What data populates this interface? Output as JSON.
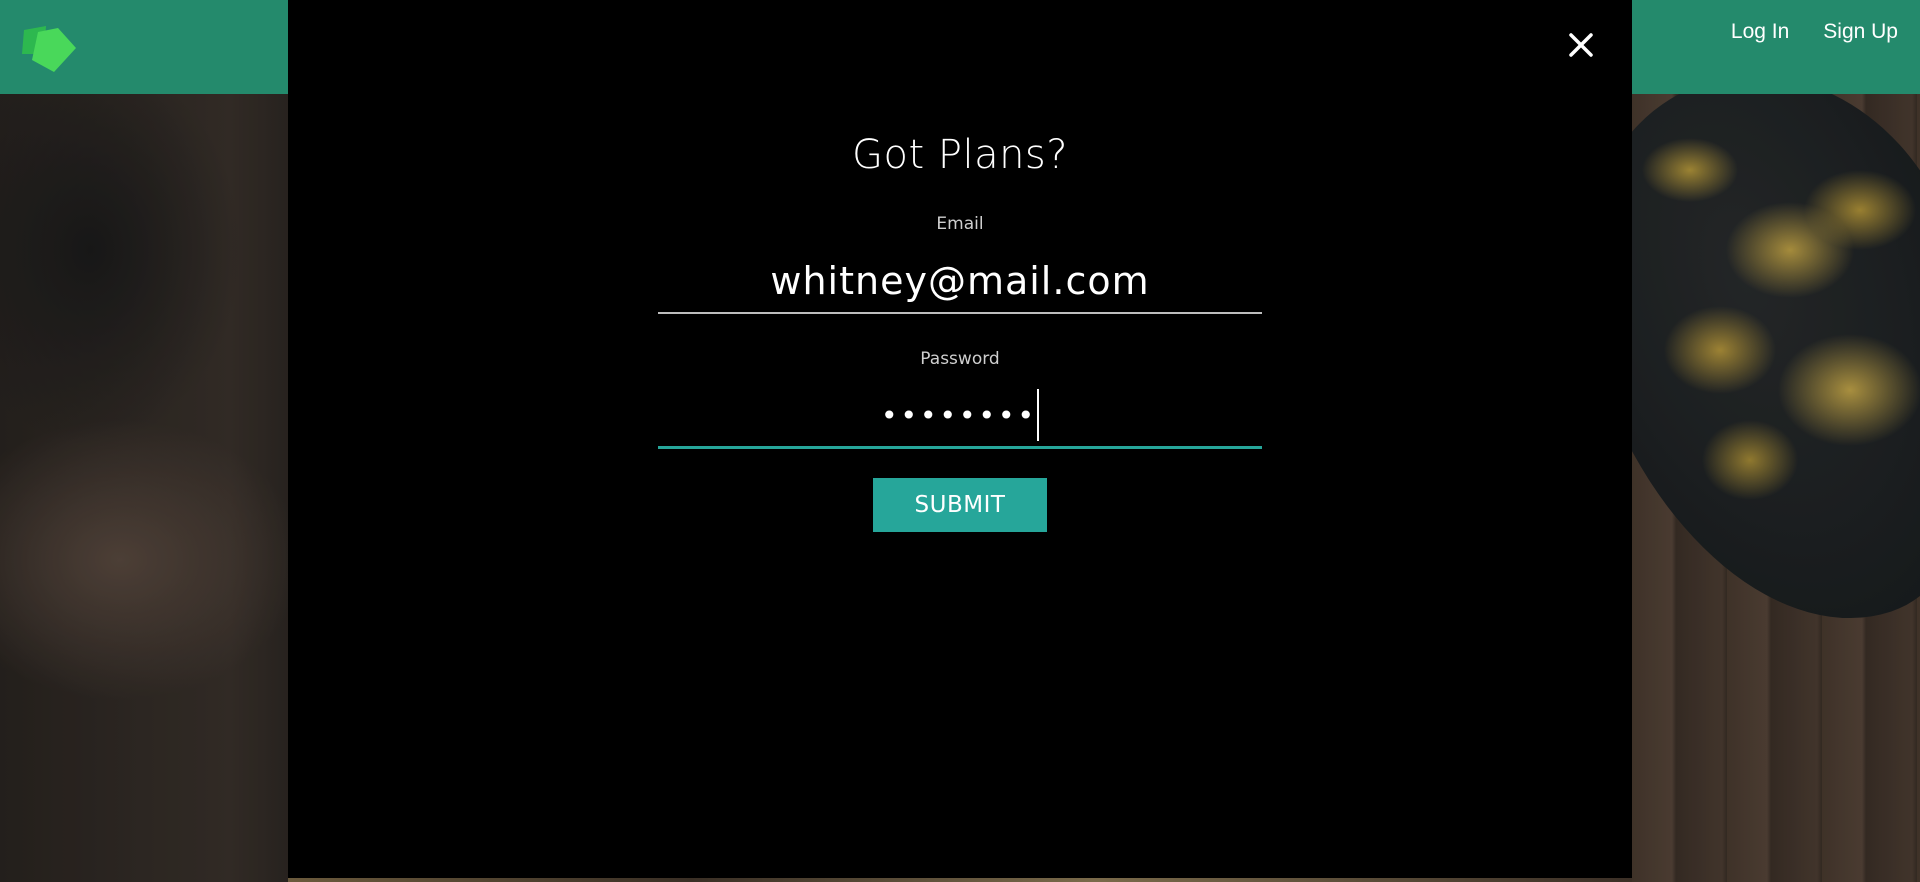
{
  "header": {
    "logo_icon": "green-diamond-logo",
    "nav": {
      "login_label": "Log In",
      "signup_label": "Sign Up"
    },
    "color": "#248a6c"
  },
  "modal": {
    "title": "Got Plans?",
    "close_icon": "close-x-icon",
    "email": {
      "label": "Email",
      "value": "whitney@mail.com"
    },
    "password": {
      "label": "Password",
      "masked_value": "••••••••"
    },
    "submit_label": "SUBMIT",
    "accent_color": "#26a69a",
    "background": "#000000"
  }
}
